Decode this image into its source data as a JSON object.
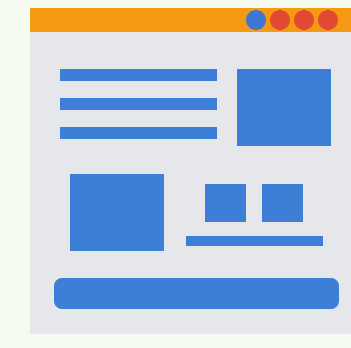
{
  "colors": {
    "background": "#f5fbee",
    "window": "#e6e7eb",
    "titlebar": "#f59a12",
    "content_blue": "#3d7fd6",
    "dot_blue": "#3d77d1",
    "dot_red": "#e34a33"
  },
  "icons": {
    "window_controls": [
      "blue-dot-icon",
      "red-dot-icon",
      "red-dot-icon",
      "red-dot-icon"
    ]
  }
}
